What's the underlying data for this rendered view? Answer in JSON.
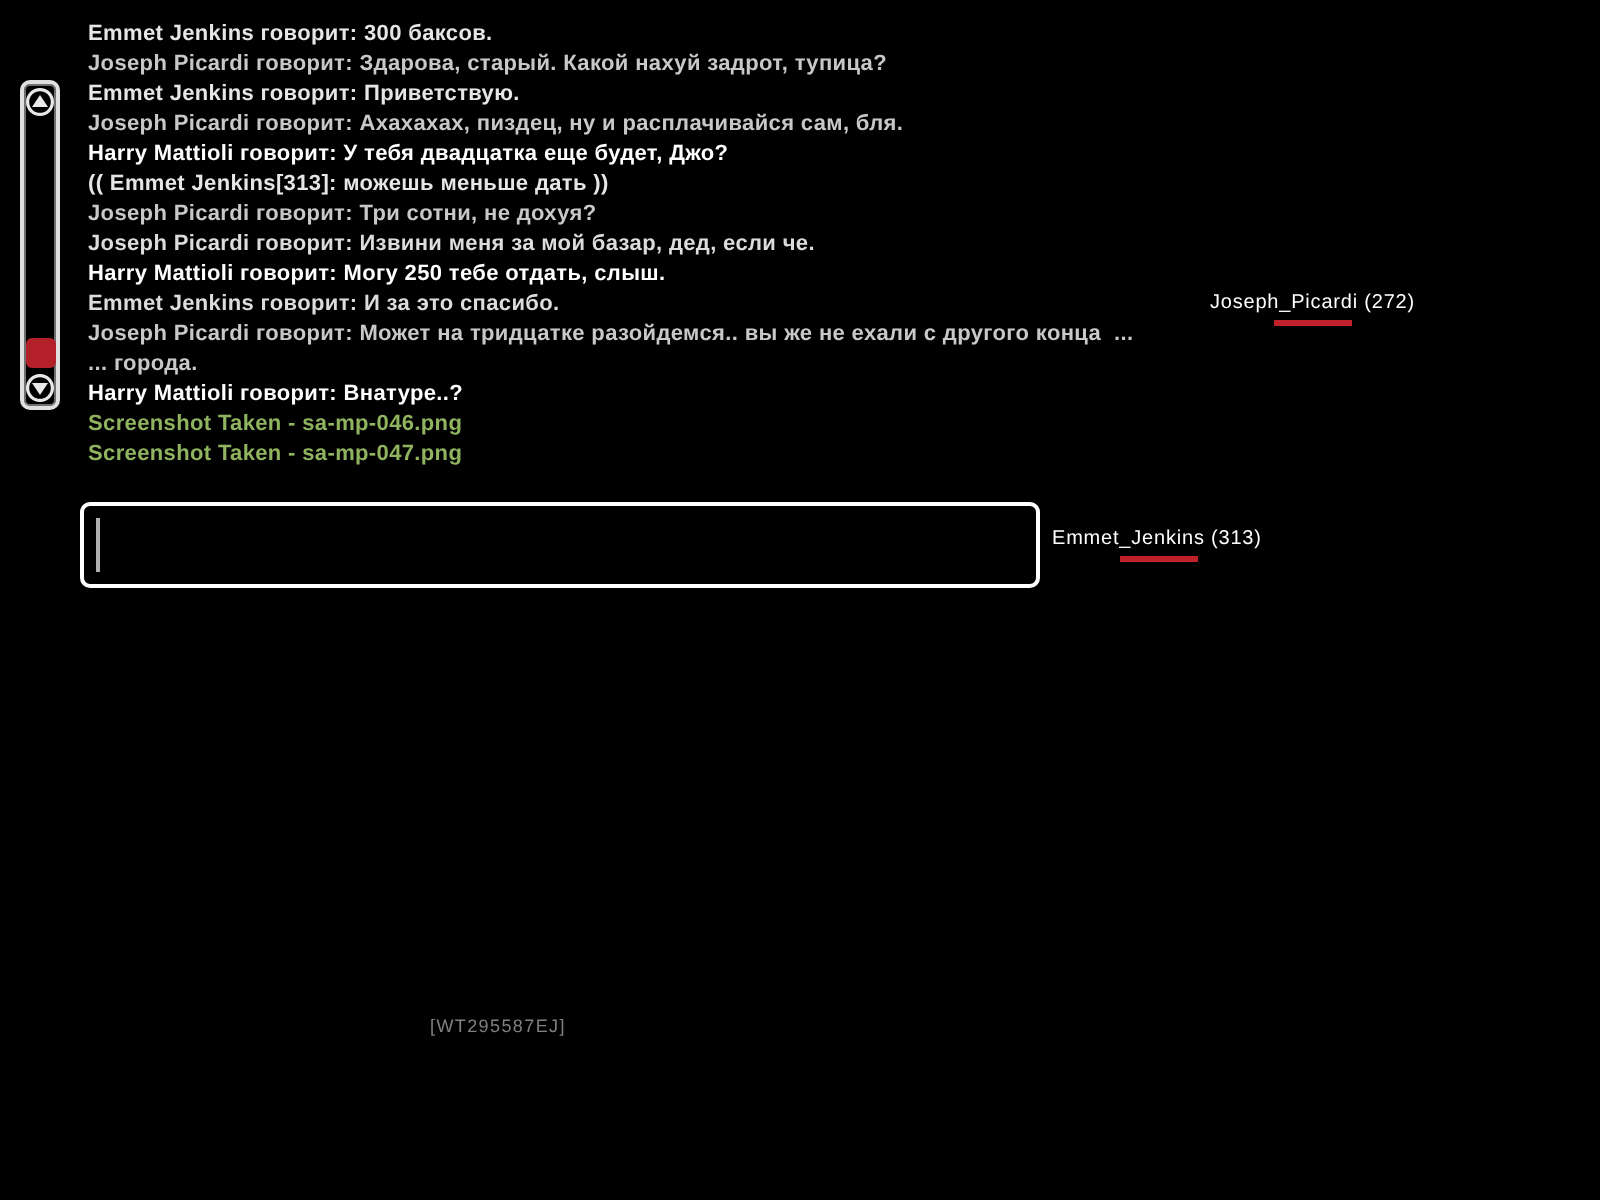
{
  "chat": {
    "lines": [
      {
        "text": "Emmet Jenkins говорит: 300 баксов.",
        "color": "#e6e6e6"
      },
      {
        "text": "Joseph Picardi говорит: Здарова, старый. Какой нахуй задрот, тупица?",
        "color": "#c8c8c8"
      },
      {
        "text": "Emmet Jenkins говорит: Приветствую.",
        "color": "#e6e6e6"
      },
      {
        "text": "Joseph Picardi говорит: Ахахахах, пиздец, ну и расплачивайся сам, бля.",
        "color": "#c8c8c8"
      },
      {
        "text": "Harry Mattioli говорит: У тебя двадцатка еще будет, Джо?",
        "color": "#ffffff"
      },
      {
        "text": "(( Emmet Jenkins[313]: можешь меньше дать ))",
        "color": "#e6e6e6"
      },
      {
        "text": "Joseph Picardi говорит: Три сотни, не дохуя?",
        "color": "#c8c8c8"
      },
      {
        "text": "Joseph Picardi говорит: Извини меня за мой базар, дед, если че.",
        "color": "#dcdcdc"
      },
      {
        "text": "Harry Mattioli говорит: Могу 250 тебе отдать, слыш.",
        "color": "#ffffff"
      },
      {
        "text": "Emmet Jenkins говорит: И за это спасибо.",
        "color": "#dcdcdc"
      },
      {
        "text": "Joseph Picardi говорит: Может на тридцатке разойдемся.. вы же не ехали с другого конца  ...",
        "color": "#c8c8c8"
      },
      {
        "text": "... города.",
        "color": "#c8c8c8"
      },
      {
        "text": "Harry Mattioli говорит: Внатуре..?",
        "color": "#ffffff"
      },
      {
        "text": "Screenshot Taken - sa-mp-046.png",
        "color": "#8fb35f"
      },
      {
        "text": "Screenshot Taken - sa-mp-047.png",
        "color": "#8fb35f"
      }
    ]
  },
  "chat_input": {
    "focused": true
  },
  "name_tags": [
    {
      "label": "Joseph_Picardi (272)",
      "level": 1
    },
    {
      "label": "Emmet_Jenkins (313)",
      "level": 1
    }
  ],
  "server_tag": "[WT295587EJ]"
}
